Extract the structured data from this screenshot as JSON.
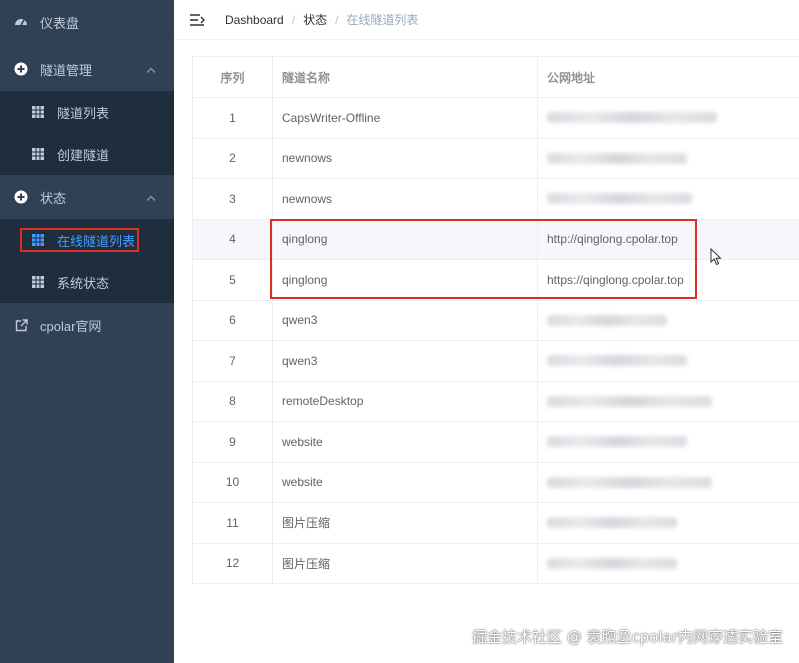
{
  "sidebar": {
    "dashboard": {
      "label": "仪表盘",
      "icon": "dashboard-icon"
    },
    "tunnel_mgmt": {
      "label": "隧道管理",
      "icon": "plus-circle-icon",
      "items": [
        {
          "label": "隧道列表",
          "icon": "table-icon"
        },
        {
          "label": "创建隧道",
          "icon": "table-icon"
        }
      ]
    },
    "status": {
      "label": "状态",
      "icon": "plus-circle-icon",
      "items": [
        {
          "label": "在线隧道列表",
          "icon": "table-icon",
          "active": true
        },
        {
          "label": "系统状态",
          "icon": "table-icon"
        }
      ]
    },
    "cpolar_site": {
      "label": "cpolar官网",
      "icon": "external-link-icon"
    }
  },
  "navbar": {
    "breadcrumb": [
      "Dashboard",
      "状态",
      "在线隧道列表"
    ]
  },
  "table": {
    "headers": [
      "序列",
      "隧道名称",
      "公网地址"
    ],
    "rows": [
      {
        "idx": "1",
        "name": "CapsWriter-Offline",
        "url": ""
      },
      {
        "idx": "2",
        "name": "newnows",
        "url": ""
      },
      {
        "idx": "3",
        "name": "newnows",
        "url": ""
      },
      {
        "idx": "4",
        "name": "qinglong",
        "url": "http://qinglong.cpolar.top"
      },
      {
        "idx": "5",
        "name": "qinglong",
        "url": "https://qinglong.cpolar.top"
      },
      {
        "idx": "6",
        "name": "qwen3",
        "url": ""
      },
      {
        "idx": "7",
        "name": "qwen3",
        "url": ""
      },
      {
        "idx": "8",
        "name": "remoteDesktop",
        "url": ""
      },
      {
        "idx": "9",
        "name": "website",
        "url": ""
      },
      {
        "idx": "10",
        "name": "website",
        "url": ""
      },
      {
        "idx": "11",
        "name": "图片压缩",
        "url": ""
      },
      {
        "idx": "12",
        "name": "图片压缩",
        "url": ""
      }
    ]
  },
  "watermark": "掘金技术社区 @ 袁煦丞cpolar内网穿透实验室",
  "colors": {
    "sidebar_bg": "#304156",
    "submenu_bg": "#1f2d3d",
    "active": "#409eff",
    "highlight": "#d93025"
  }
}
